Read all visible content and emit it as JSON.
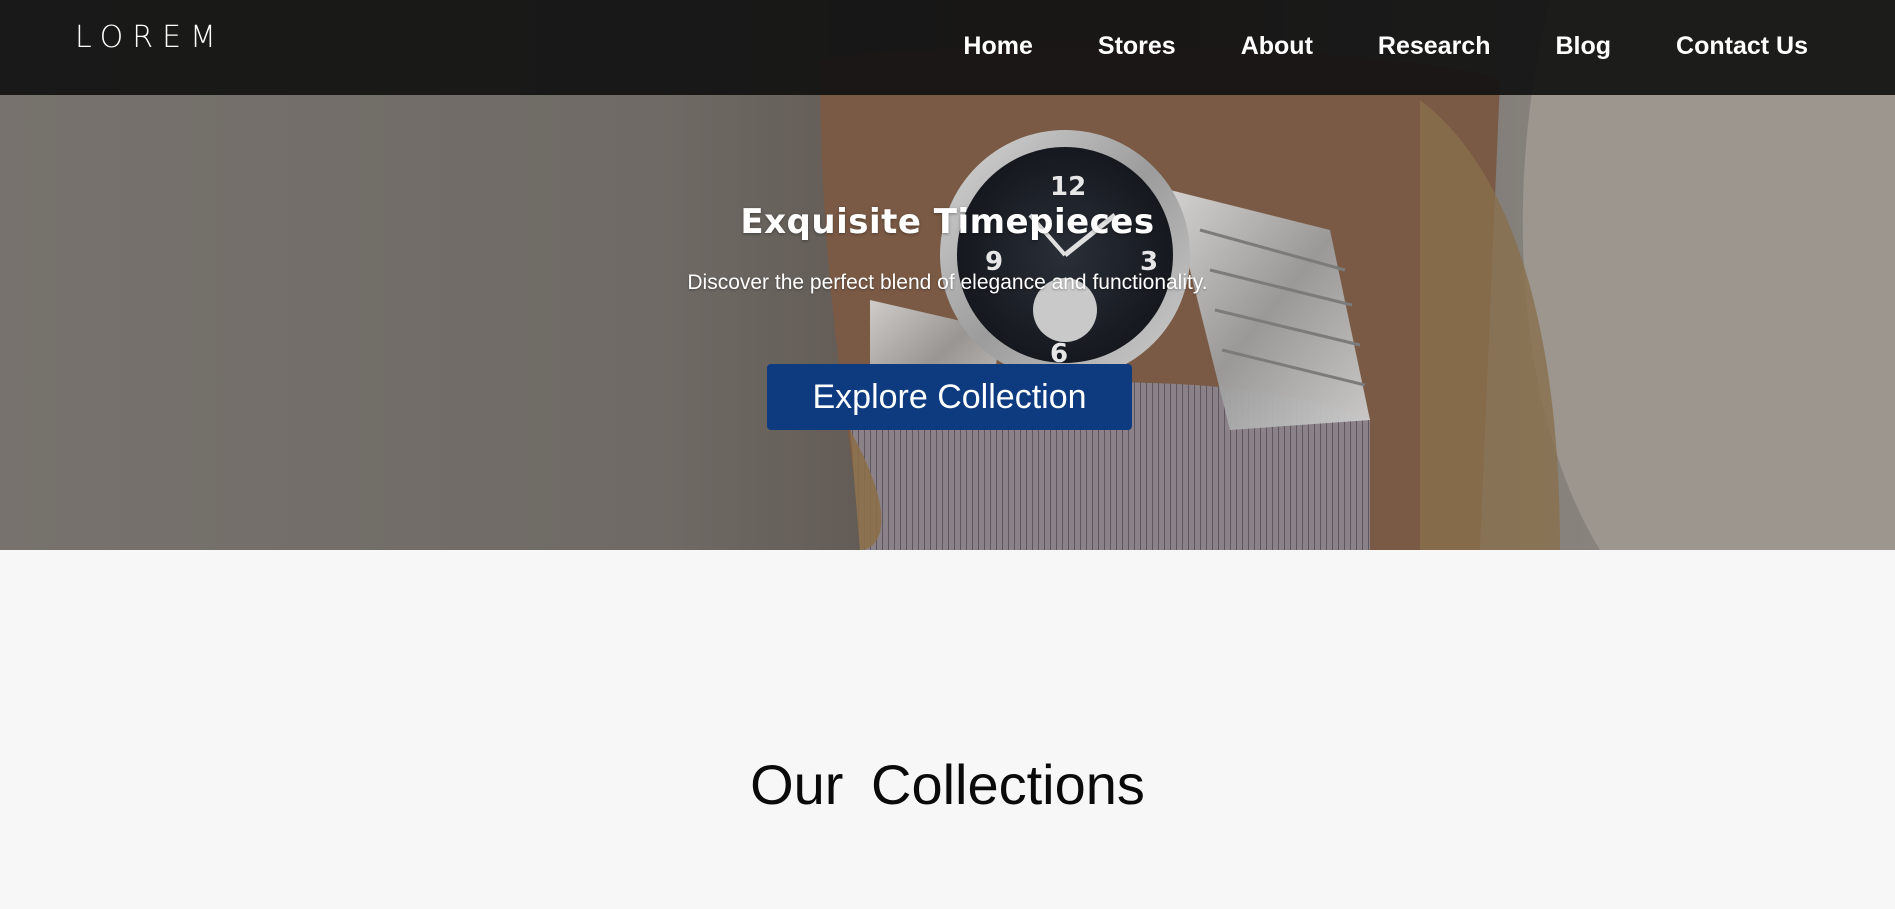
{
  "brand": {
    "logo_text": "LOREM"
  },
  "nav": {
    "items": [
      {
        "label": "Home"
      },
      {
        "label": "Stores"
      },
      {
        "label": "About"
      },
      {
        "label": "Research"
      },
      {
        "label": "Blog"
      },
      {
        "label": "Contact Us"
      }
    ]
  },
  "hero": {
    "title": "Exquisite Timepieces",
    "subtitle": "Discover the perfect blend of elegance and functionality.",
    "cta_label": "Explore Collection",
    "image_icon": "wristwatch-photo",
    "cta_color": "#0e3a80"
  },
  "collections": {
    "heading": "Our  Collections"
  },
  "colors": {
    "navbar": "#121212",
    "page_bg": "#f7f7f7",
    "heading_text": "#0a0a0a"
  }
}
